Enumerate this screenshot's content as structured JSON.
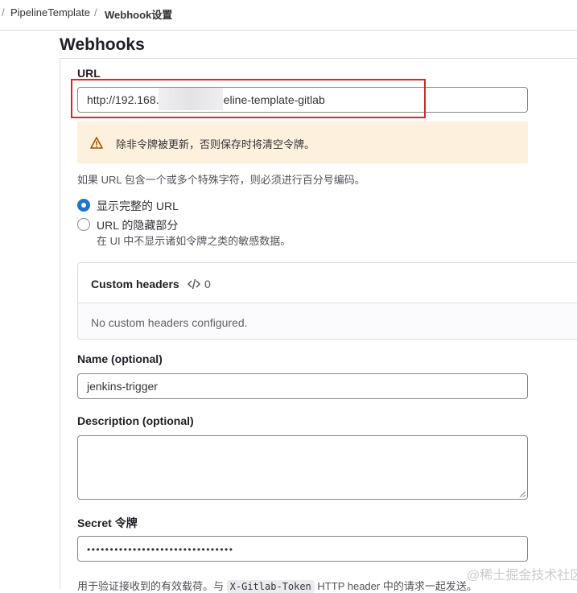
{
  "breadcrumb": {
    "separator": "/",
    "items": [
      "PipelineTemplate",
      "Webhook设置"
    ]
  },
  "page": {
    "title": "Webhooks"
  },
  "url_field": {
    "label": "URL",
    "value": "http://192.168.          0/project/pipeline-template-gitlab"
  },
  "alert": {
    "icon": "warning-icon",
    "text": "除非令牌被更新，否则保存时将清空令牌。",
    "background": "#fdf1dd"
  },
  "url_help": "如果 URL 包含一个或多个特殊字符，则必须进行百分号编码。",
  "url_display": {
    "options": [
      {
        "label": "显示完整的 URL",
        "checked": true
      },
      {
        "label": "URL 的隐藏部分",
        "checked": false
      }
    ],
    "masked_help": "在 UI 中不显示诸如令牌之类的敏感数据。"
  },
  "custom_headers": {
    "title": "Custom headers",
    "icon": "code-icon",
    "count": "0",
    "empty_text": "No custom headers configured."
  },
  "name_field": {
    "label": "Name (optional)",
    "value": "jenkins-trigger"
  },
  "description_field": {
    "label": "Description (optional)",
    "value": ""
  },
  "secret_field": {
    "label": "Secret 令牌",
    "value": "••••••••••••••••••••••••••••••••"
  },
  "secret_help": {
    "prefix": "用于验证接收到的有效载荷。与",
    "code": "X-Gitlab-Token",
    "suffix": "HTTP header 中的请求一起发送。"
  },
  "watermark": "@稀土掘金技术社区",
  "colors": {
    "primary": "#1f75cb",
    "highlight_border": "#d12a2a"
  }
}
